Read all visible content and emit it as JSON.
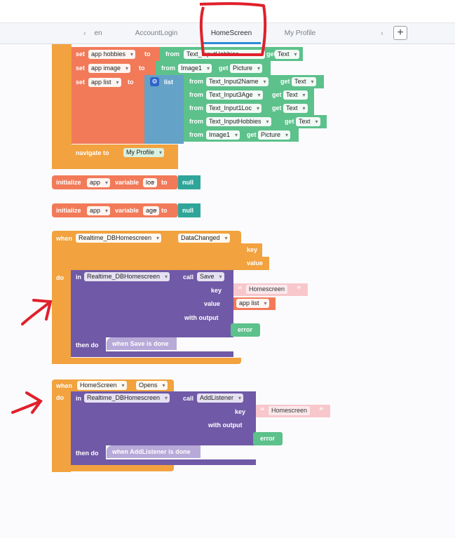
{
  "tabs": {
    "partial_left": "en",
    "items": [
      "AccountLogin",
      "HomeScreen",
      "My Profile"
    ],
    "active": "HomeScreen",
    "add_button": "+"
  },
  "blocks": {
    "set_hobbies": {
      "set": "set",
      "var": "app hobbies",
      "to": "to",
      "from": "from",
      "comp": "Text_InputHobbies",
      "get": "get",
      "prop": "Text"
    },
    "set_image": {
      "set": "set",
      "var": "app image",
      "to": "to",
      "from": "from",
      "comp": "Image1",
      "get": "get",
      "prop": "Picture"
    },
    "set_list": {
      "set": "set",
      "var": "app list",
      "to": "to",
      "list_label": "list",
      "items": [
        {
          "from": "from",
          "comp": "Text_Input2Name",
          "get": "get",
          "prop": "Text"
        },
        {
          "from": "from",
          "comp": "Text_Input3Age",
          "get": "get",
          "prop": "Text"
        },
        {
          "from": "from",
          "comp": "Text_Input1Loc",
          "get": "get",
          "prop": "Text"
        },
        {
          "from": "from",
          "comp": "Text_InputHobbies",
          "get": "get",
          "prop": "Text"
        },
        {
          "from": "from",
          "comp": "Image1",
          "get": "get",
          "prop": "Picture"
        }
      ]
    },
    "navigate": {
      "label": "navigate to",
      "target": "My Profile"
    },
    "init_loc": {
      "initialize": "initialize",
      "scope": "app",
      "variable": "variable",
      "name": "loc",
      "to": "to",
      "value": "null"
    },
    "init_age": {
      "initialize": "initialize",
      "scope": "app",
      "variable": "variable",
      "name": "age",
      "to": "to",
      "value": "null"
    },
    "when_data": {
      "when": "when",
      "comp": "Realtime_DBHomescreen",
      "event": "DataChanged",
      "p1": "key",
      "p2": "value",
      "do": "do",
      "call": {
        "in": "in",
        "comp": "Realtime_DBHomescreen",
        "call": "call",
        "method": "Save",
        "key": "key",
        "key_val": "Homescreen",
        "value": "value",
        "value_val": "app list",
        "with_output": "with output",
        "error": "error",
        "then_do": "then do",
        "done": "when Save is done"
      }
    },
    "when_opens": {
      "when": "when",
      "comp": "HomeScreen",
      "event": "Opens",
      "do": "do",
      "call": {
        "in": "in",
        "comp": "Realtime_DBHomescreen",
        "call": "call",
        "method": "AddListener",
        "key": "key",
        "key_val": "Homescreen",
        "with_output": "with output",
        "error": "error",
        "then_do": "then do",
        "done": "when AddListener is done"
      }
    }
  },
  "colors": {
    "accent_tab": "#2a8bd6",
    "event": "#f2a23e",
    "set": "#f27a59",
    "component": "#5cc18b",
    "call": "#7059a6",
    "annotation": "#e0202a"
  }
}
